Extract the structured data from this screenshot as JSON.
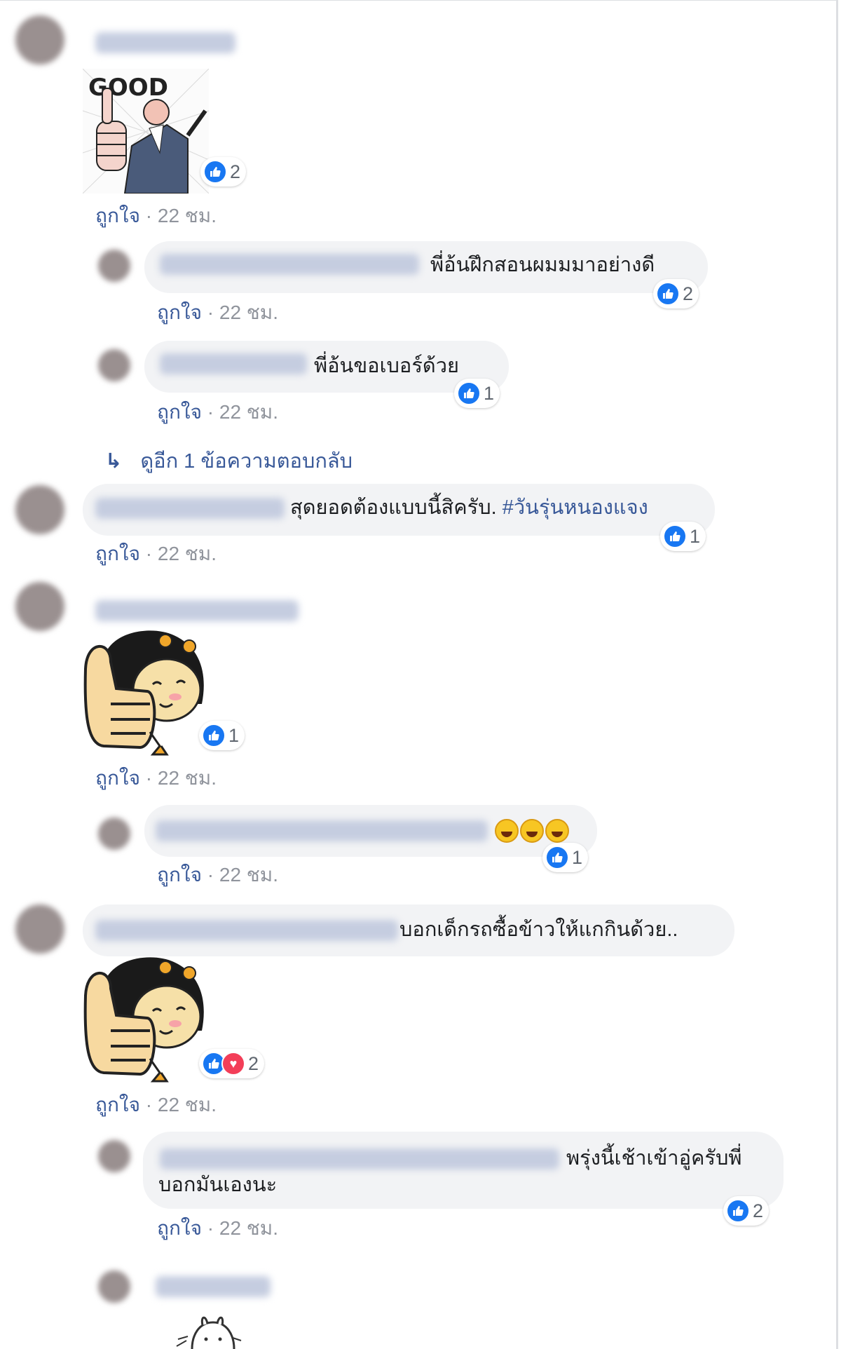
{
  "comments": [
    {
      "sticker": "good-thumbs-up-businessman-sticker",
      "sticker_text": "GOOD",
      "reactions": {
        "count": "2"
      },
      "like": "ถูกใจ",
      "sep": "·",
      "time": "22 ชม.",
      "replies": [
        {
          "text": "พี่อ้นฝึกสอนผมมมาอย่างดี",
          "reactions": {
            "count": "2"
          },
          "like": "ถูกใจ",
          "sep": "·",
          "time": "22 ชม."
        },
        {
          "text": "พี่อ้นขอเบอร์ด้วย",
          "reactions": {
            "count": "1"
          },
          "like": "ถูกใจ",
          "sep": "·",
          "time": "22 ชม."
        }
      ],
      "more_replies": "ดูอีก 1 ข้อความตอบกลับ"
    },
    {
      "text": "สุดยอดต้องแบบนี้สิครับ.",
      "hashtag": "#วันรุ่นหนองแจง",
      "reactions": {
        "count": "1"
      },
      "like": "ถูกใจ",
      "sep": "·",
      "time": "22 ชม."
    },
    {
      "sticker": "thumbs-up-girl-sticker",
      "reactions": {
        "count": "1"
      },
      "like": "ถูกใจ",
      "sep": "·",
      "time": "22 ชม.",
      "replies": [
        {
          "emojis": [
            "rolling-laughing-emoji",
            "rolling-laughing-emoji",
            "rolling-laughing-emoji"
          ],
          "reactions": {
            "count": "1"
          },
          "like": "ถูกใจ",
          "sep": "·",
          "time": "22 ชม."
        }
      ]
    },
    {
      "text": "บอกเด็กรถซื้อข้าวให้แกกินด้วย..",
      "sticker": "thumbs-up-girl-sticker",
      "reactions": {
        "count": "2",
        "types": [
          "like",
          "love"
        ]
      },
      "like": "ถูกใจ",
      "sep": "·",
      "time": "22 ชม.",
      "replies": [
        {
          "text_line1": "พรุ่งนี้เช้าเข้าอู่ครับพี่",
          "text_line2": "บอกมันเองนะ",
          "reactions": {
            "count": "2"
          },
          "like": "ถูกใจ",
          "sep": "·",
          "time": "22 ชม."
        }
      ]
    }
  ],
  "colors": {
    "link": "#385898",
    "bubble": "#f2f3f5",
    "like_blue": "#1877f2",
    "love_red": "#f33e58"
  }
}
